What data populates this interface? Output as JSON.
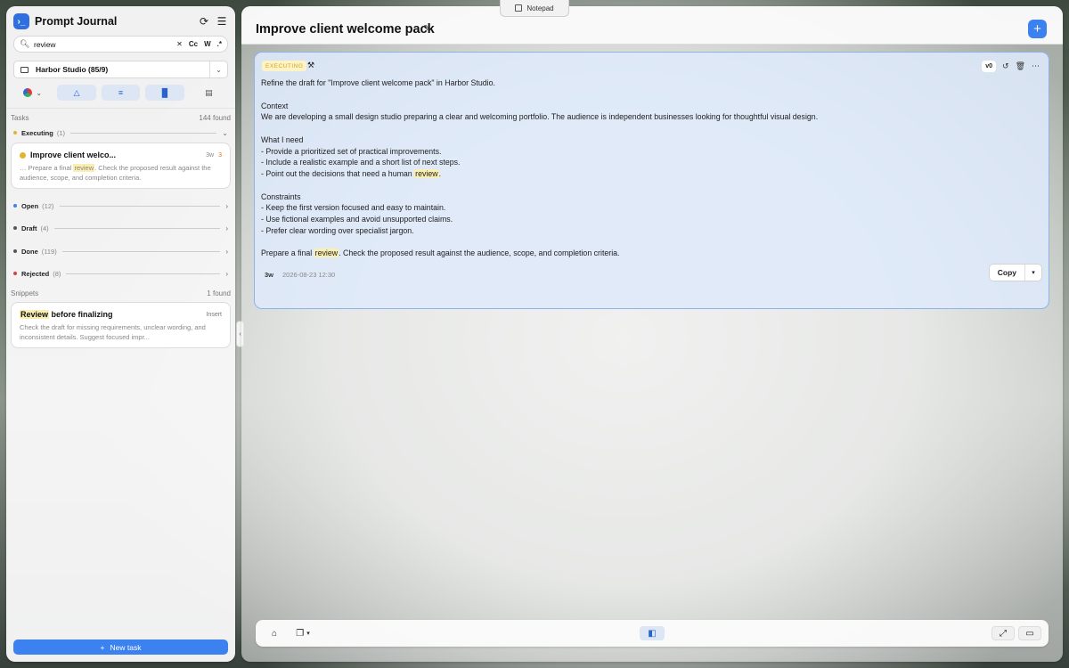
{
  "notepad_tab": {
    "label": "Notepad",
    "icon": "notepad-icon"
  },
  "app": {
    "title": "Prompt Journal",
    "logo_glyph": "›_",
    "icons": [
      "refresh-icon",
      "menu-icon"
    ]
  },
  "search": {
    "value": "review",
    "placeholder": "Search",
    "options": [
      "Cc",
      "W",
      ".*"
    ]
  },
  "project": {
    "label": "Harbor Studio (85/9)"
  },
  "filters": [
    "color-filter",
    "shapes-filter",
    "list-filter",
    "chart-filter",
    "layout-filter"
  ],
  "tasks_section": {
    "label": "Tasks",
    "count": "144 found",
    "groups": [
      {
        "label": "Executing",
        "count": "(1)",
        "color": "#e1b52d",
        "expanded": true
      },
      {
        "label": "Open",
        "count": "(12)",
        "color": "#3b82f0"
      },
      {
        "label": "Draft",
        "count": "(4)",
        "color": "#555555"
      },
      {
        "label": "Done",
        "count": "(119)",
        "color": "#555555"
      },
      {
        "label": "Rejected",
        "count": "(8)",
        "color": "#d64242"
      }
    ]
  },
  "task_card": {
    "title": "Improve client welco...",
    "age": "3w",
    "num": "3",
    "snippet_pre": "… Prepare a final ",
    "snippet_mark": "review",
    "snippet_post": ". Check the proposed result against the audience, scope, and completion criteria."
  },
  "snippets_section": {
    "label": "Snippets",
    "count": "1 found"
  },
  "snippet_card": {
    "title_mark": "Review",
    "title_rest": " before finalizing",
    "action": "Insert",
    "body": "Check the draft for missing requirements, unclear wording, and inconsistent details. Suggest focused impr..."
  },
  "new_task_button": {
    "label": "New task",
    "icon": "+"
  },
  "main": {
    "title": "Improve client welcome pack",
    "add_icon": "+",
    "card": {
      "status": "EXECUTING",
      "version": "v0",
      "lines": [
        {
          "text": "Refine the draft for \"Improve client welcome pack\" in Harbor Studio."
        },
        {
          "gap": true
        },
        {
          "text": "Context"
        },
        {
          "text": "We are developing a small design studio preparing a clear and welcoming portfolio. The audience is independent businesses looking for thoughtful visual design."
        },
        {
          "gap": true
        },
        {
          "text": "What I need"
        },
        {
          "text": "- Provide a prioritized set of practical improvements."
        },
        {
          "text": "- Include a realistic example and a short list of next steps."
        },
        {
          "pre": "- Point out the decisions that need a human ",
          "mark": "review",
          "post": "."
        },
        {
          "gap": true
        },
        {
          "text": "Constraints"
        },
        {
          "text": "- Keep the first version focused and easy to maintain."
        },
        {
          "text": "- Use fictional examples and avoid unsupported claims."
        },
        {
          "text": "- Prefer clear wording over specialist jargon."
        },
        {
          "gap": true
        },
        {
          "pre": "Prepare a final ",
          "mark": "review",
          "post": ". Check the proposed result against the audience, scope, and completion criteria."
        }
      ],
      "meta_age": "3w",
      "meta_date": "2026-08-23 12:30",
      "copy_label": "Copy"
    }
  },
  "colors": {
    "accent": "#3b82f0",
    "executing": "#e1b52d",
    "highlight": "#fbeeb1"
  }
}
